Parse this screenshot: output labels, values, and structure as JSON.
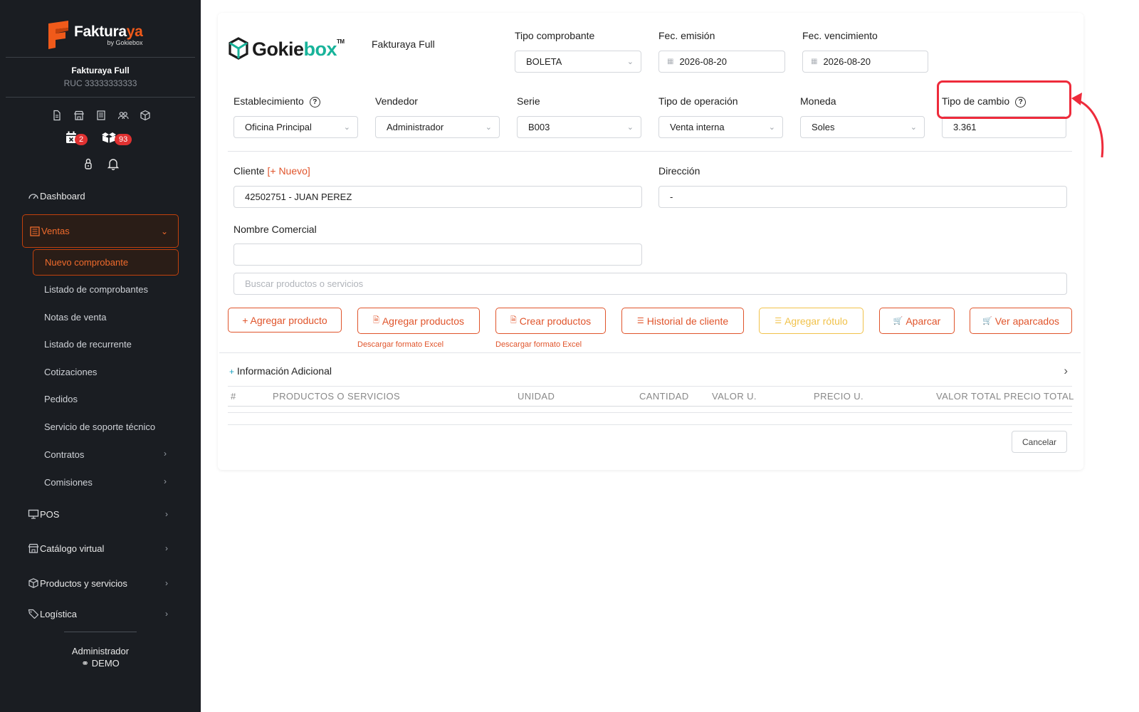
{
  "sidebar": {
    "brand_name_main": "Faktura",
    "brand_name_accent": "ya",
    "brand_sub": "by Gokiebox",
    "company_name": "Fakturaya Full",
    "company_ruc": "RUC 33333333333",
    "quick_icons": [
      "document-icon",
      "store-icon",
      "receipt-icon",
      "users-icon",
      "box-icon"
    ],
    "badges": [
      {
        "icon": "calendar-x-icon",
        "count": "2"
      },
      {
        "icon": "boxes-icon",
        "count": "93"
      }
    ],
    "nav": {
      "dashboard": "Dashboard",
      "ventas": "Ventas",
      "ventas_sub": [
        "Nuevo comprobante",
        "Listado de comprobantes",
        "Notas de venta",
        "Listado de recurrente",
        "Cotizaciones",
        "Pedidos",
        "Servicio de soporte técnico",
        "Contratos",
        "Comisiones"
      ],
      "pos": "POS",
      "catalogo": "Catálogo virtual",
      "productos": "Productos y servicios",
      "logistica": "Logística"
    },
    "user_name": "Administrador",
    "user_mode": "DEMO"
  },
  "form": {
    "logo_main": "Gokie",
    "logo_accent": "box",
    "logo_tm": "TM",
    "company_label": "Fakturaya Full",
    "tipo_comprobante": {
      "label": "Tipo comprobante",
      "value": "BOLETA"
    },
    "fec_emision": {
      "label": "Fec. emisión",
      "value": "2026-08-20"
    },
    "fec_vencimiento": {
      "label": "Fec. vencimiento",
      "value": "2026-08-20"
    },
    "establecimiento": {
      "label": "Establecimiento",
      "value": "Oficina Principal"
    },
    "vendedor": {
      "label": "Vendedor",
      "value": "Administrador"
    },
    "serie": {
      "label": "Serie",
      "value": "B003"
    },
    "tipo_operacion": {
      "label": "Tipo de operación",
      "value": "Venta interna"
    },
    "moneda": {
      "label": "Moneda",
      "value": "Soles"
    },
    "tipo_cambio": {
      "label": "Tipo de cambio",
      "value": "3.361"
    },
    "cliente": {
      "label": "Cliente",
      "new_link": "[+ Nuevo]",
      "value": "42502751 - JUAN PEREZ"
    },
    "direccion": {
      "label": "Dirección",
      "value": "-"
    },
    "nombre_comercial": {
      "label": "Nombre Comercial",
      "value": ""
    },
    "buscar_placeholder": "Buscar productos o servicios"
  },
  "buttons": {
    "agregar_producto": "+ Agregar producto",
    "agregar_productos": "Agregar productos",
    "crear_productos": "Crear productos",
    "historial_cliente": "Historial de cliente",
    "agregar_rotulo": "Agregar rótulo",
    "aparcar": "Aparcar",
    "ver_aparcados": "Ver aparcados",
    "descargar_formato": "Descargar formato Excel",
    "cancelar": "Cancelar"
  },
  "info_adicional": "Información Adicional",
  "table_headers": [
    "#",
    "PRODUCTOS O SERVICIOS",
    "UNIDAD",
    "CANTIDAD",
    "VALOR U.",
    "PRECIO U.",
    "VALOR TOTAL",
    "PRECIO TOTAL"
  ],
  "colors": {
    "accent": "#e0542b",
    "sidebar_bg": "#1a1d22",
    "highlight": "#ee2b3b",
    "brand_teal": "#18b39a",
    "warning": "#f1c24a"
  }
}
